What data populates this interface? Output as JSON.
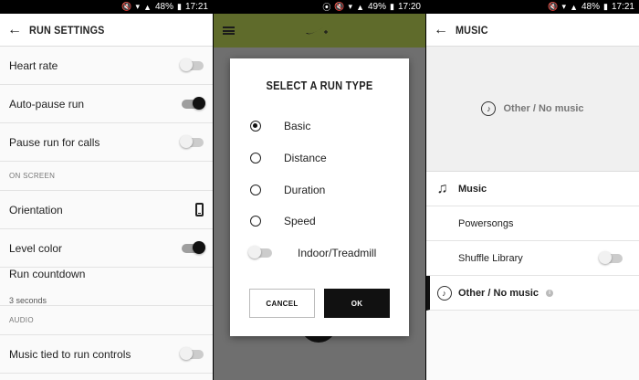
{
  "screen1": {
    "status": {
      "battery": "48%",
      "time": "17:21"
    },
    "title": "RUN SETTINGS",
    "rows": [
      {
        "label": "Heart rate",
        "toggle": "off"
      },
      {
        "label": "Auto-pause run",
        "toggle": "on"
      },
      {
        "label": "Pause run for calls",
        "toggle": "off"
      }
    ],
    "section_on_screen": "ON SCREEN",
    "orientation_label": "Orientation",
    "level_color_label": "Level color",
    "level_color_toggle": "on",
    "run_countdown_label": "Run countdown",
    "run_countdown_value": "3 seconds",
    "section_audio": "AUDIO",
    "music_tied_label": "Music tied to run controls",
    "music_tied_toggle": "off"
  },
  "screen2": {
    "status": {
      "battery": "49%",
      "time": "17:20"
    },
    "dialog": {
      "title": "SELECT A RUN TYPE",
      "options": [
        {
          "label": "Basic",
          "selected": true
        },
        {
          "label": "Distance",
          "selected": false
        },
        {
          "label": "Duration",
          "selected": false
        },
        {
          "label": "Speed",
          "selected": false
        }
      ],
      "indoor_label": "Indoor/Treadmill",
      "indoor_toggle": "off",
      "cancel_label": "CANCEL",
      "ok_label": "OK"
    }
  },
  "screen3": {
    "status": {
      "battery": "48%",
      "time": "17:21"
    },
    "title": "MUSIC",
    "hero_label": "Other / No music",
    "rows": {
      "music": "Music",
      "powersongs": "Powersongs",
      "shuffle": "Shuffle Library",
      "other": "Other / No music"
    },
    "shuffle_toggle": "off"
  },
  "colors": {
    "nike_bar": "#5f6b2b",
    "toggle_on": "#111111",
    "dialog_bg": "#ffffff"
  }
}
